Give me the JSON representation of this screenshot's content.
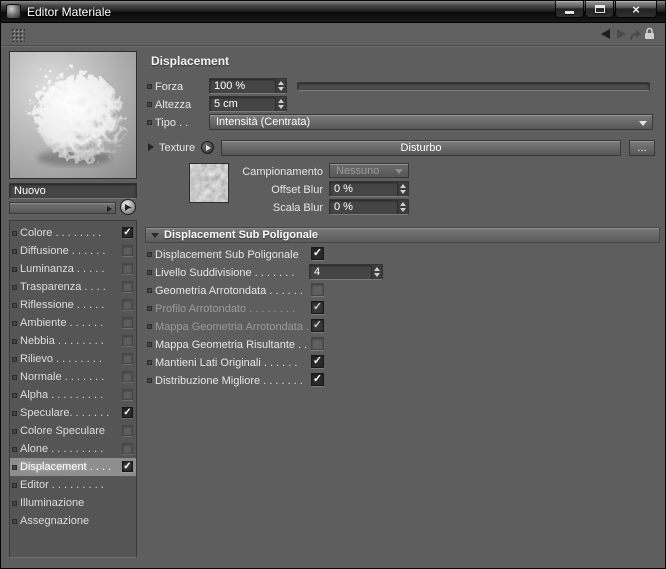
{
  "colors": {
    "window_bg": "#5e5e5e",
    "titlebar": "#141414",
    "selection": "#8e8e8e",
    "field_bg": "#454545",
    "text": "#e6e6e6"
  },
  "window": {
    "title": "Editor Materiale"
  },
  "icons": {
    "close": "×",
    "check": "✓"
  },
  "sidebar": {
    "name_value": "Nuovo",
    "channels": [
      {
        "label": "Colore . . . . . . . .",
        "check": "✓"
      },
      {
        "label": "Diffusione . . . . . .",
        "check": ""
      },
      {
        "label": "Luminanza . . . . .",
        "check": ""
      },
      {
        "label": "Trasparenza . . . .",
        "check": ""
      },
      {
        "label": "Riflessione . . . . .",
        "check": ""
      },
      {
        "label": "Ambiente . . . . . .",
        "check": ""
      },
      {
        "label": "Nebbia . . . . . . . .",
        "check": ""
      },
      {
        "label": "Rilievo . . . . . . . .",
        "check": ""
      },
      {
        "label": "Normale . . . . . . .",
        "check": ""
      },
      {
        "label": "Alpha . . . . . . . . .",
        "check": ""
      },
      {
        "label": "Speculare. . . . . . .",
        "check": "✓"
      },
      {
        "label": "Colore Speculare",
        "check": ""
      },
      {
        "label": "Alone . . . . . . . . .",
        "check": ""
      },
      {
        "label": "Displacement . . . .",
        "check": "✓"
      },
      {
        "label": "Editor . . . . . . . . ."
      },
      {
        "label": "Illuminazione"
      },
      {
        "label": "Assegnazione"
      }
    ]
  },
  "panel": {
    "title": "Displacement",
    "forza_label": "Forza",
    "forza_value": "100 %",
    "altezza_label": "Altezza",
    "altezza_value": "5 cm",
    "tipo_label": "Tipo . .",
    "tipo_value": "Intensità (Centrata)",
    "texture_label": "Texture",
    "texture_button": "Disturbo",
    "texture_more": "...",
    "campionamento_label": "Campionamento",
    "campionamento_value": "Nessuno",
    "offset_blur_label": "Offset Blur",
    "offset_blur_value": "0 %",
    "scala_blur_label": "Scala Blur",
    "scala_blur_value": "0 %",
    "section_title": "Displacement Sub Poligonale",
    "rows": [
      {
        "label": "Displacement Sub Poligonale",
        "check": "✓"
      },
      {
        "label": "Livello Suddivisione . . . . . . .",
        "value": "4"
      },
      {
        "label": "Geometria Arrotondata . . . . . .",
        "check": ""
      },
      {
        "label": "Profilo Arrotondato . . . . . . . .",
        "check": "✓"
      },
      {
        "label": "Mappa Geometria Arrotondata . .",
        "check": "✓"
      },
      {
        "label": "Mappa Geometria Risultante . . .",
        "check": ""
      },
      {
        "label": "Mantieni Lati Originali . . . . . .",
        "check": "✓"
      },
      {
        "label": "Distribuzione Migliore . . . . . . .",
        "check": "✓"
      }
    ]
  }
}
